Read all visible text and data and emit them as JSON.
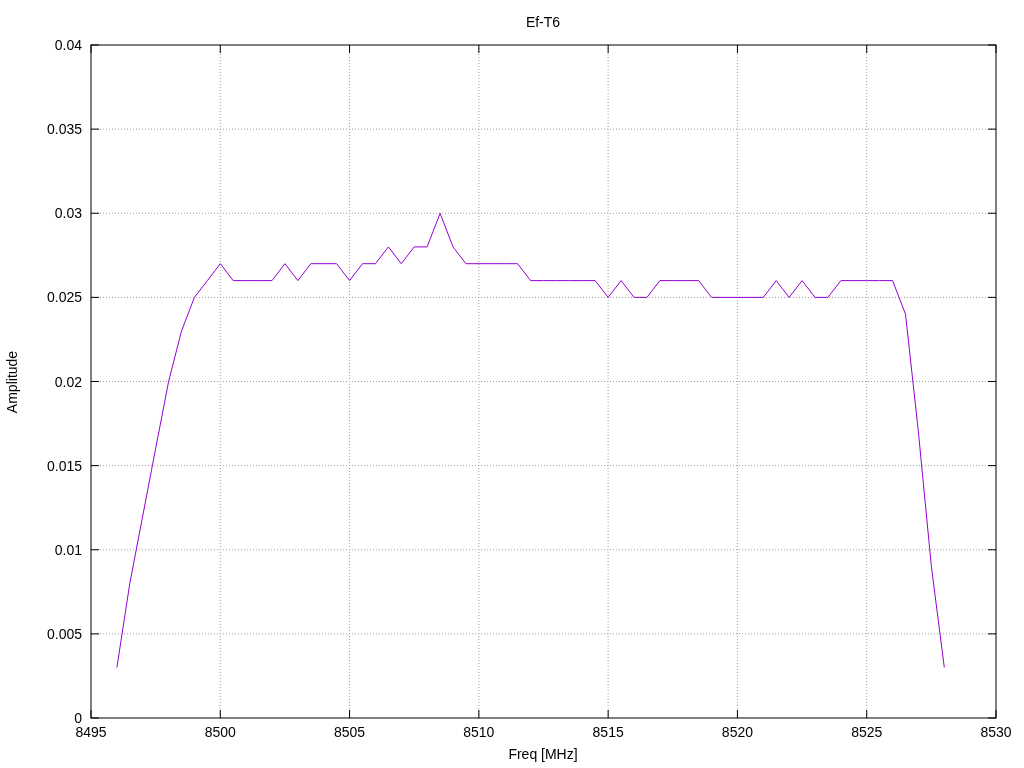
{
  "chart_data": {
    "type": "line",
    "title": "Ef-T6",
    "xlabel": "Freq [MHz]",
    "ylabel": "Amplitude",
    "grid": true,
    "xlim": [
      8495,
      8530
    ],
    "ylim": [
      0,
      0.04
    ],
    "xticks": [
      8495,
      8500,
      8505,
      8510,
      8515,
      8520,
      8525,
      8530
    ],
    "yticks": [
      {
        "value": 0,
        "label": "0"
      },
      {
        "value": 0.005,
        "label": "0.005"
      },
      {
        "value": 0.01,
        "label": "0.01"
      },
      {
        "value": 0.015,
        "label": "0.015"
      },
      {
        "value": 0.02,
        "label": "0.02"
      },
      {
        "value": 0.025,
        "label": "0.025"
      },
      {
        "value": 0.03,
        "label": "0.03"
      },
      {
        "value": 0.035,
        "label": "0.035"
      },
      {
        "value": 0.04,
        "label": "0.04"
      }
    ],
    "x": [
      8496,
      8496.5,
      8497,
      8497.5,
      8498,
      8498.5,
      8499,
      8499.5,
      8500,
      8500.5,
      8501,
      8501.5,
      8502,
      8502.5,
      8503,
      8503.5,
      8504,
      8504.5,
      8505,
      8505.5,
      8506,
      8506.5,
      8507,
      8507.5,
      8508,
      8508.5,
      8509,
      8509.5,
      8510,
      8510.5,
      8511,
      8511.5,
      8512,
      8512.5,
      8513,
      8513.5,
      8514,
      8514.5,
      8515,
      8515.5,
      8516,
      8516.5,
      8517,
      8517.5,
      8518,
      8518.5,
      8519,
      8519.5,
      8520,
      8520.5,
      8521,
      8521.5,
      8522,
      8522.5,
      8523,
      8523.5,
      8524,
      8524.5,
      8525,
      8525.5,
      8526,
      8526.5,
      8527,
      8527.5,
      8528
    ],
    "series": [
      {
        "color": "#9400d3",
        "values": [
          0.003,
          0.008,
          0.012,
          0.016,
          0.02,
          0.023,
          0.025,
          0.026,
          0.027,
          0.026,
          0.026,
          0.026,
          0.026,
          0.027,
          0.026,
          0.027,
          0.027,
          0.027,
          0.026,
          0.027,
          0.027,
          0.028,
          0.027,
          0.028,
          0.028,
          0.03,
          0.028,
          0.027,
          0.027,
          0.027,
          0.027,
          0.027,
          0.026,
          0.026,
          0.026,
          0.026,
          0.026,
          0.026,
          0.025,
          0.026,
          0.025,
          0.025,
          0.026,
          0.026,
          0.026,
          0.026,
          0.025,
          0.025,
          0.025,
          0.025,
          0.025,
          0.026,
          0.025,
          0.026,
          0.025,
          0.025,
          0.026,
          0.026,
          0.026,
          0.026,
          0.026,
          0.024,
          0.017,
          0.009,
          0.003
        ]
      }
    ]
  }
}
